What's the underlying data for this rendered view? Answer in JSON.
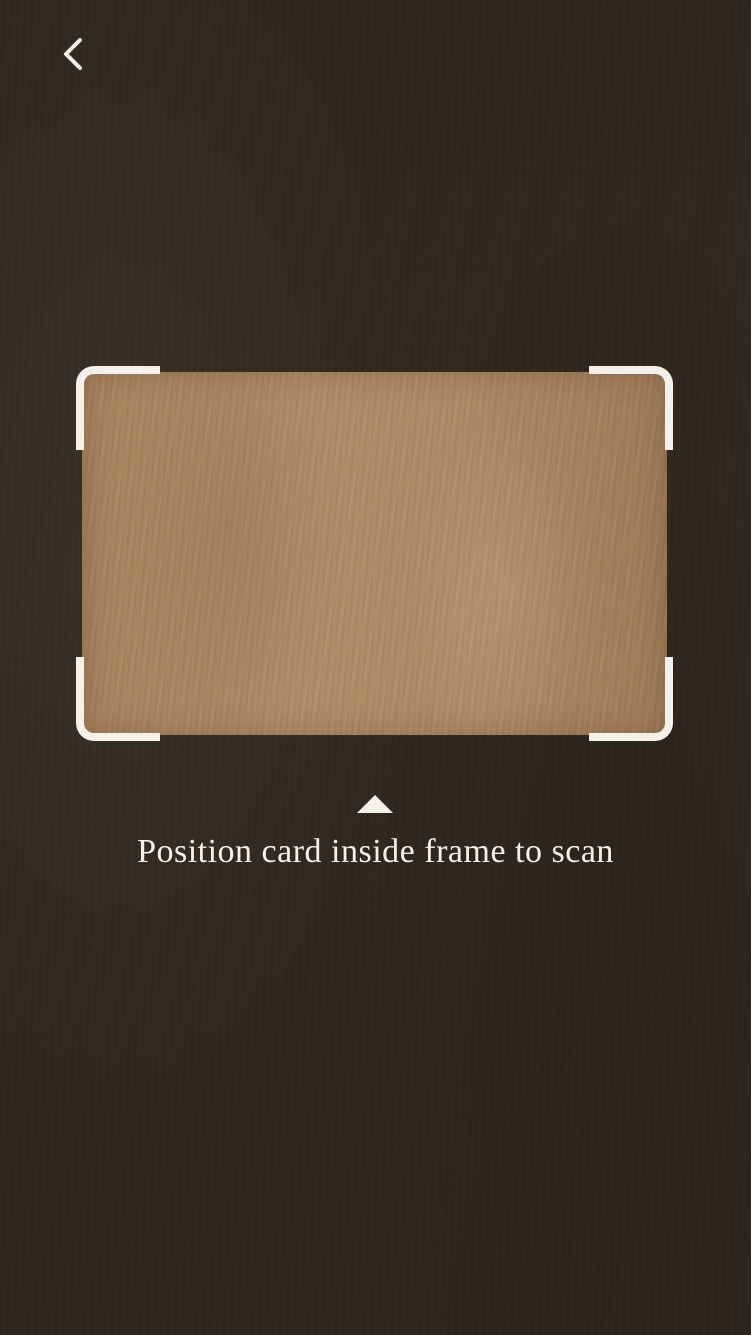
{
  "screen": {
    "background_color": "#2f2620",
    "accent_color": "#f4f1ec",
    "card_color": "#ad8a66"
  },
  "header": {
    "back_icon": "chevron-left-icon"
  },
  "scanner": {
    "frame_icon": "scan-frame-corners",
    "hint_icon": "triangle-up-icon",
    "instruction": "Position card inside frame to scan"
  }
}
